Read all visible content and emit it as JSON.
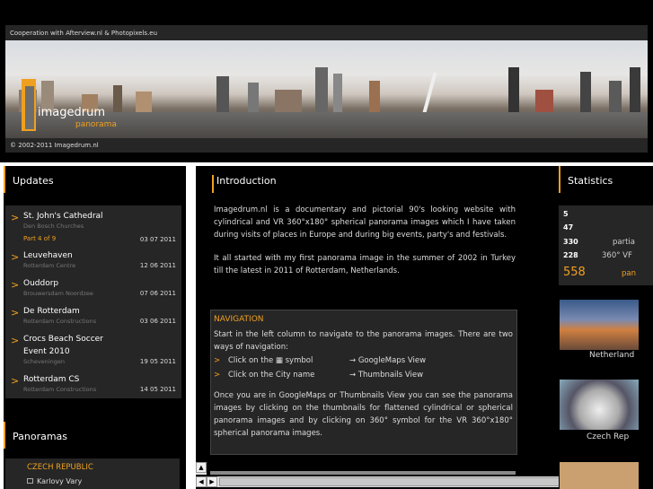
{
  "header": {
    "cooperation": "Cooperation with Afterview.nl & Photopixels.eu",
    "copyright": "© 2002-2011 Imagedrum.nl",
    "logo_main": "imagedrum",
    "logo_sub": "panorama",
    "accent": "#f0a020"
  },
  "updates": {
    "title": "Updates",
    "items": [
      {
        "title": "St. John's Cathedral",
        "sub": "Den Bosch Churches",
        "part": "Part 4 of 9",
        "date": "03 07 2011"
      },
      {
        "title": "Leuvehaven",
        "sub": "Rotterdam Centre",
        "date": "12 06 2011"
      },
      {
        "title": "Ouddorp",
        "sub": "Brouwersdam Noordzee",
        "date": "07 06 2011"
      },
      {
        "title": "De Rotterdam",
        "sub": "Rotterdam Constructions",
        "date": "03 06 2011"
      },
      {
        "title": "Crocs Beach Soccer Event 2010",
        "sub": "Scheveningen",
        "date": "19 05 2011"
      },
      {
        "title": "Rotterdam CS",
        "sub": "Rotterdam Constructions",
        "date": "14 05 2011"
      }
    ]
  },
  "panoramas": {
    "title": "Panoramas",
    "country": "CZECH REPUBLIC",
    "city": "Karlovy Vary"
  },
  "intro": {
    "title": "Introduction",
    "p1": "Imagedrum.nl is a documentary and pictorial 90's looking website with cylindrical and VR 360°x180° spherical panorama images which I have taken during visits of places in Europe and during big events, party's and festivals.",
    "p2": "It all started with my first panorama image in the summer of 2002 in Turkey till the latest in 2011 of Rotterdam, Netherlands."
  },
  "navigation": {
    "title": "NAVIGATION",
    "text": "Start in the left column to navigate to the panorama images. There are two ways of navigation:",
    "rows": [
      {
        "left": "Click on the ▦ symbol",
        "right": "→  GoogleMaps View"
      },
      {
        "left": "Click on the City name",
        "right": "→  Thumbnails View"
      }
    ],
    "text2": "Once you are in GoogleMaps or Thumbnails View you can see the panorama images by clicking on the thumbnails for flattened cylindrical or spherical panorama images and by clicking on 360° symbol for the VR 360°x180° spherical panorama images."
  },
  "statistics": {
    "title": "Statistics",
    "rows": [
      {
        "num": "5",
        "txt": ""
      },
      {
        "num": "47",
        "txt": ""
      },
      {
        "num": "330",
        "txt": "partia"
      },
      {
        "num": "228",
        "txt": "360° VF"
      }
    ],
    "total": "558",
    "total_txt": "pan",
    "thumbs": [
      "Netherland",
      "Czech Rep"
    ]
  },
  "scroll": {
    "up": "▲",
    "down": "▼",
    "left": "◀",
    "right": "▶"
  }
}
